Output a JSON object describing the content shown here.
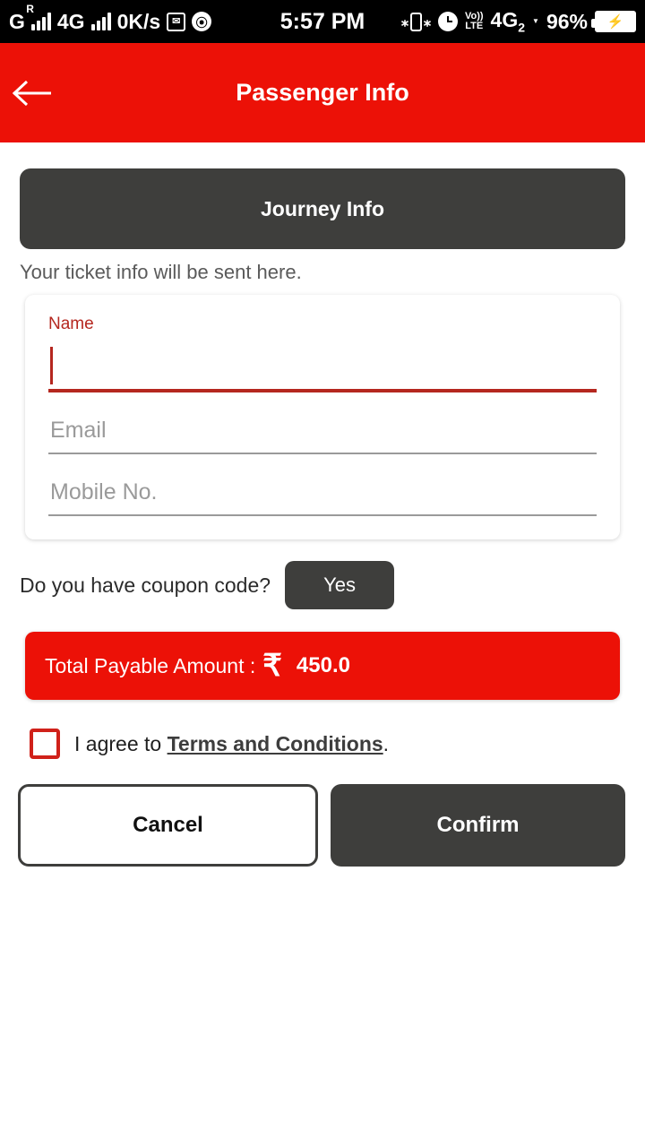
{
  "status_bar": {
    "network_label": "G",
    "roaming_badge": "R",
    "network_type": "4G",
    "data_speed": "0K/s",
    "message_icon": "envelope-icon",
    "browser_icon": "chrome-icon",
    "time": "5:57 PM",
    "vibrate_icon": "vibrate-icon",
    "alarm_icon": "alarm-clock-icon",
    "volte_top": "Vo))",
    "volte_bottom": "LTE",
    "sim2_network": "4G",
    "sim2_index": "2",
    "battery_percent": "96%",
    "charging_icon": "charging-bolt-icon"
  },
  "app_bar": {
    "back_icon": "back-arrow-icon",
    "title": "Passenger Info",
    "background": "#EC1107"
  },
  "main": {
    "journey_button": "Journey Info",
    "helper_text": "Your ticket info will be sent here.",
    "form": {
      "name": {
        "label": "Name",
        "value": "",
        "placeholder": ""
      },
      "email": {
        "label": "Email",
        "value": "",
        "placeholder": "Email"
      },
      "mobile": {
        "label": "Mobile No.",
        "value": "",
        "placeholder": "Mobile No."
      }
    },
    "coupon": {
      "question": "Do you have coupon code?",
      "yes_label": "Yes"
    },
    "total": {
      "label": "Total Payable Amount :",
      "currency_symbol": "₹",
      "amount": "450.0",
      "background": "#EC1107"
    },
    "terms": {
      "prefix": "I agree to ",
      "link": "Terms and Conditions",
      "suffix": ".",
      "checked": false,
      "checkbox_color": "#D0211A"
    },
    "actions": {
      "cancel": "Cancel",
      "confirm": "Confirm"
    }
  },
  "theme": {
    "primary_red": "#EC1107",
    "field_red": "#B5271F",
    "dark_button": "#3E3E3C"
  }
}
